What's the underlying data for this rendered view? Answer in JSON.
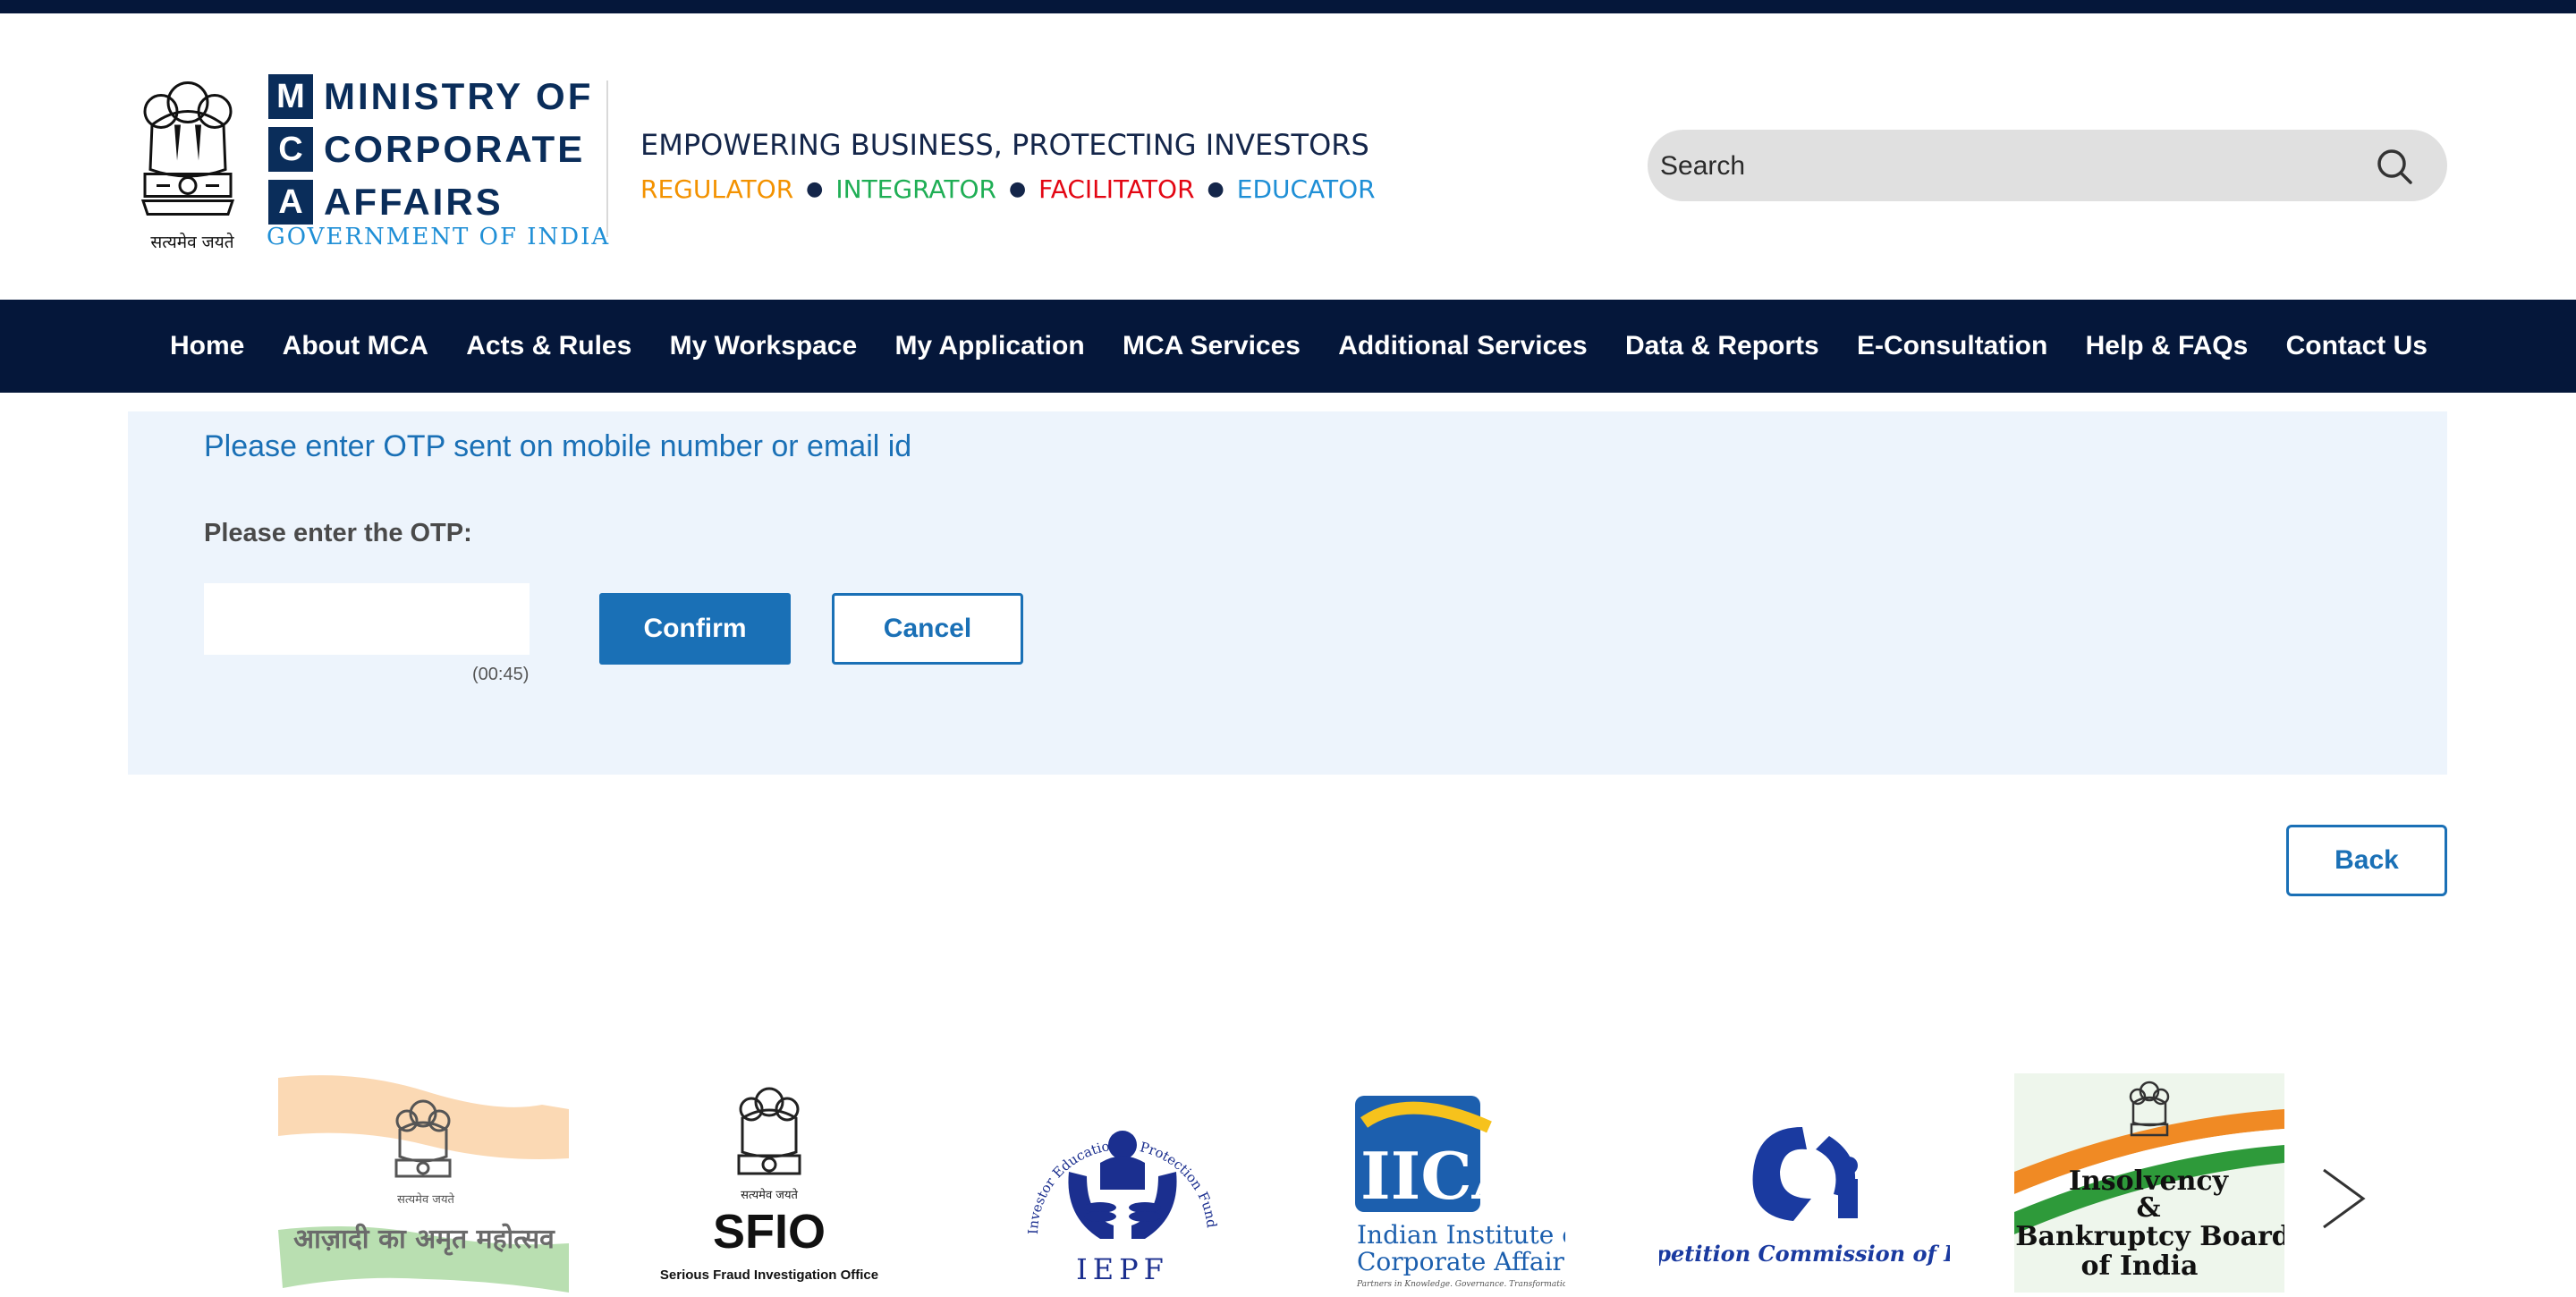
{
  "header": {
    "emblem_caption": "सत्यमेव जयते",
    "mca_letters": [
      "M",
      "C",
      "A"
    ],
    "mca_words": [
      "MINISTRY OF",
      "CORPORATE",
      "AFFAIRS"
    ],
    "gov_label": "GOVERNMENT OF INDIA",
    "tagline": "EMPOWERING BUSINESS, PROTECTING INVESTORS",
    "roles": [
      {
        "label": "REGULATOR",
        "color": "#f39200"
      },
      {
        "label": "INTEGRATOR",
        "color": "#1fae55"
      },
      {
        "label": "FACILITATOR",
        "color": "#e30613"
      },
      {
        "label": "EDUCATOR",
        "color": "#1f8fd6"
      }
    ],
    "search_placeholder": "Search"
  },
  "nav": {
    "items": [
      "Home",
      "About MCA",
      "Acts & Rules",
      "My Workspace",
      "My Application",
      "MCA Services",
      "Additional Services",
      "Data & Reports",
      "E-Consultation",
      "Help & FAQs",
      "Contact Us"
    ]
  },
  "otp": {
    "message": "Please enter OTP sent on mobile number or email id",
    "label": "Please enter the OTP:",
    "value": "",
    "timer": "(00:45)",
    "confirm_label": "Confirm",
    "cancel_label": "Cancel"
  },
  "back_label": "Back",
  "logos": {
    "azadi_caption": "सत्यमेव जयते",
    "azadi_text": "आज़ादी का अमृत महोत्सव",
    "sfio_caption": "सत्यमेव जयते",
    "sfio_title": "SFIO",
    "sfio_sub": "Serious Fraud Investigation Office",
    "iepf_arc": "Investor Education & Protection Fund Authority",
    "iepf_title": "IEPF",
    "iica_title": "IICA",
    "iica_line1": "Indian Institute of",
    "iica_line2": "Corporate Affairs",
    "iica_tag": "Partners in Knowledge. Governance. Transformation.",
    "cci_text": "Competition Commission of India",
    "ibbi_line1": "Insolvency",
    "ibbi_line2": "&",
    "ibbi_line3": "Bankruptcy Board",
    "ibbi_line4": "of India"
  },
  "colors": {
    "navy": "#05173a",
    "brand_blue": "#1a70b6",
    "panel_bg": "#edf4fc",
    "mca_box": "#0a2d5a"
  }
}
